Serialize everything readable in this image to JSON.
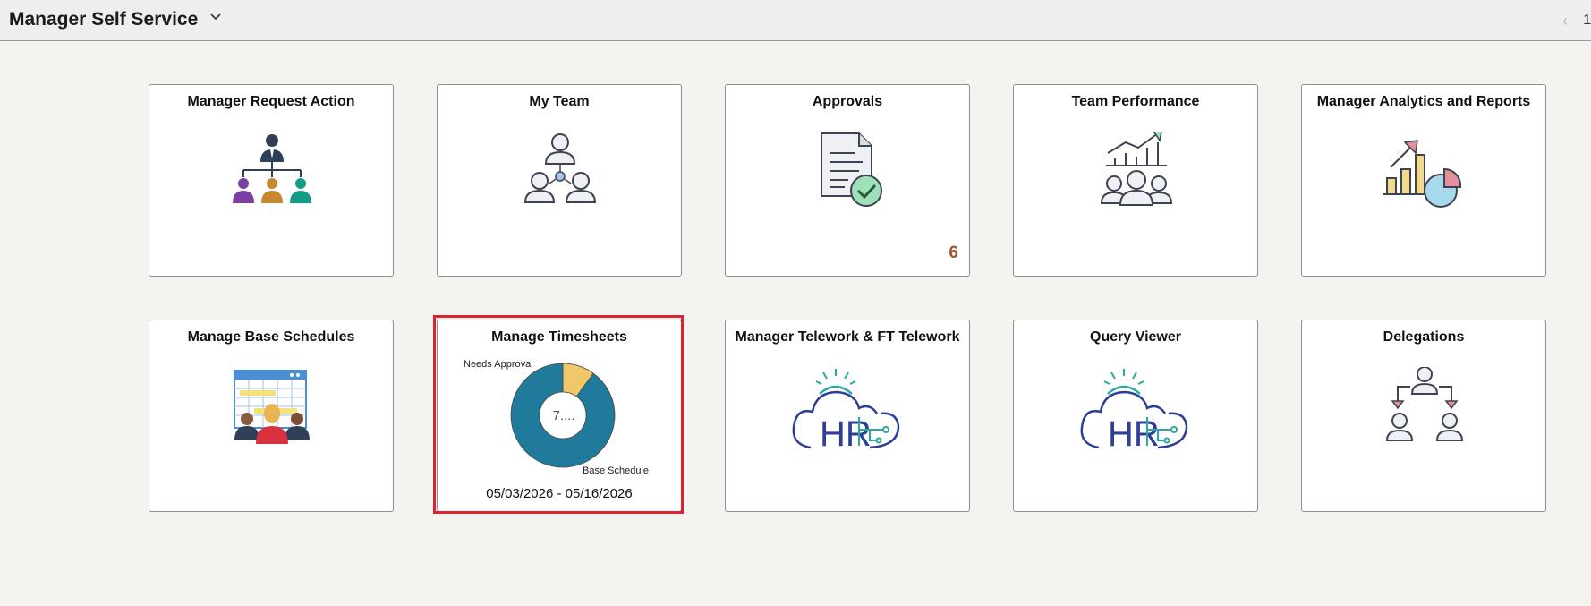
{
  "header": {
    "title": "Manager Self Service",
    "page": "1"
  },
  "tiles": {
    "request_action": {
      "title": "Manager Request Action"
    },
    "my_team": {
      "title": "My Team"
    },
    "approvals": {
      "title": "Approvals",
      "badge": "6"
    },
    "team_performance": {
      "title": "Team Performance"
    },
    "analytics": {
      "title": "Manager Analytics and Reports"
    },
    "base_schedules": {
      "title": "Manage Base Schedules"
    },
    "timesheets": {
      "title": "Manage Timesheets",
      "date_range": "05/03/2026 - 05/16/2026",
      "center_value": "7....",
      "labels": {
        "needs_approval": "Needs Approval",
        "base_schedule": "Base Schedule"
      }
    },
    "telework": {
      "title": "Manager Telework & FT Telework",
      "logo_text": "HR"
    },
    "query_viewer": {
      "title": "Query Viewer",
      "logo_text": "HR"
    },
    "delegations": {
      "title": "Delegations"
    }
  },
  "chart_data": {
    "type": "pie",
    "categories": [
      "Needs Approval",
      "Base Schedule"
    ],
    "values": [
      10,
      90
    ],
    "colors": [
      "#f0c86a",
      "#1f7a9c"
    ]
  },
  "colors": {
    "highlight": "#d9252f",
    "badge": "#a0542b",
    "donut_main": "#1f7a9c",
    "donut_secondary": "#f0c86a"
  }
}
